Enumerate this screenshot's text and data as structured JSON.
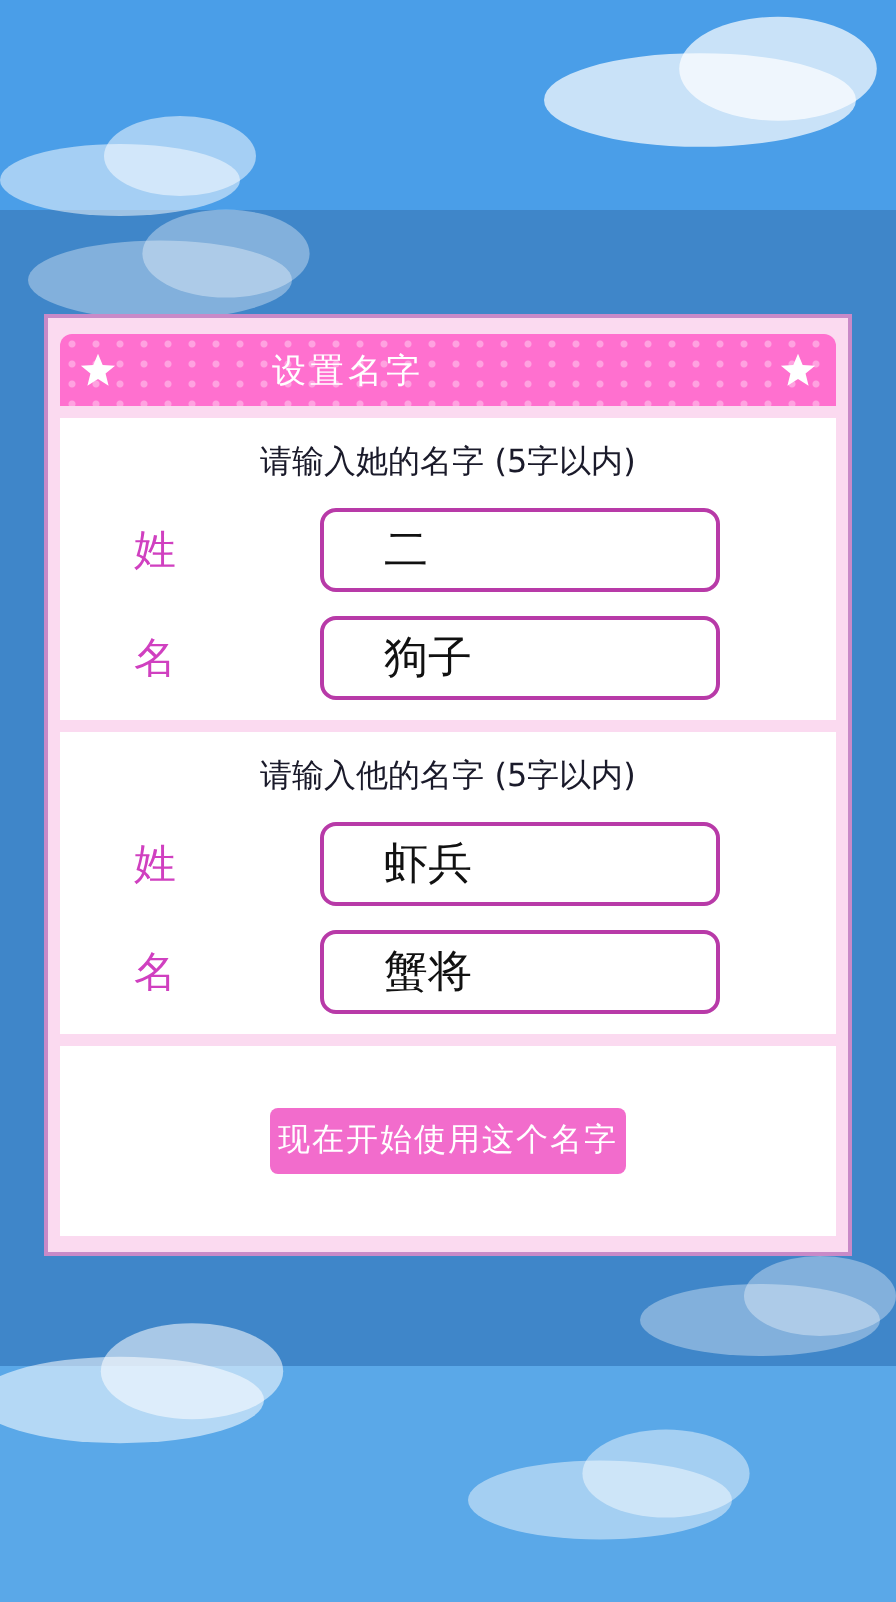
{
  "dialog": {
    "title": "设置名字",
    "sections": [
      {
        "prompt": "请输入她的名字 (5字以内)",
        "fields": [
          {
            "label": "姓",
            "value": "二"
          },
          {
            "label": "名",
            "value": "狗子"
          }
        ]
      },
      {
        "prompt": "请输入他的名字 (5字以内)",
        "fields": [
          {
            "label": "姓",
            "value": "虾兵"
          },
          {
            "label": "名",
            "value": "蟹将"
          }
        ]
      }
    ],
    "start_button": "现在开始使用这个名字"
  }
}
